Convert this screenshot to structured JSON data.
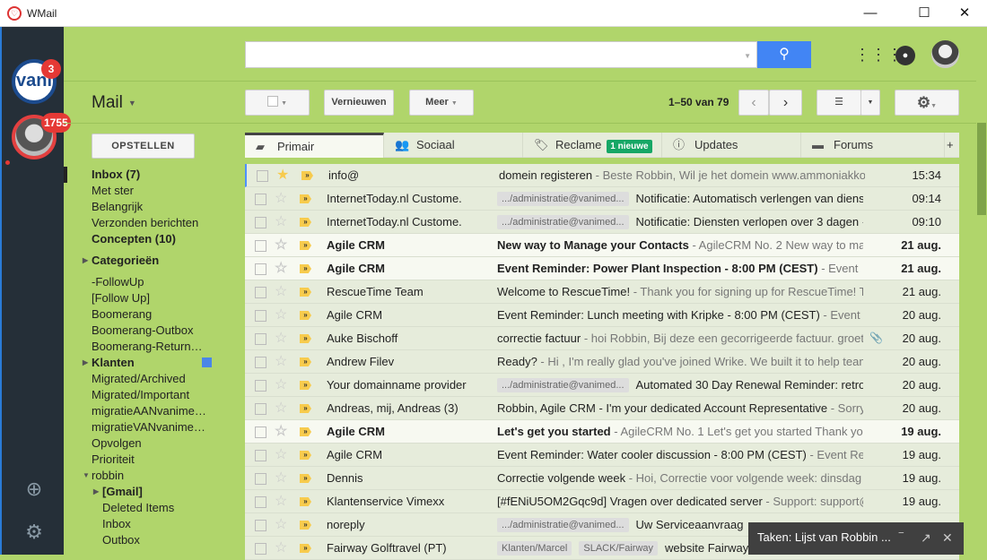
{
  "window": {
    "title": "WMail",
    "minimize": "—",
    "maximize": "☐",
    "close": "✕"
  },
  "accounts": [
    {
      "name": "vani",
      "badge": "3"
    },
    {
      "name": "robbin",
      "badge": "1755"
    }
  ],
  "search": {
    "placeholder": ""
  },
  "header": {
    "mail_label": "Mail"
  },
  "toolbar": {
    "refresh": "Vernieuwen",
    "more": "Meer",
    "pagination": "1–50 van 79"
  },
  "compose": "OPSTELLEN",
  "nav": {
    "inbox": "Inbox (7)",
    "starred": "Met ster",
    "important": "Belangrijk",
    "sent": "Verzonden berichten",
    "drafts": "Concepten (10)",
    "categories": "Categorieën",
    "labels": [
      "-FollowUp",
      "[Follow Up]",
      "Boomerang",
      "Boomerang-Outbox",
      "Boomerang-Return…"
    ],
    "klanten": "Klanten",
    "labels2": [
      "Migrated/Archived",
      "Migrated/Important",
      "migratieAANvanime…",
      "migratieVANvanime…",
      "Opvolgen",
      "Prioriteit"
    ],
    "robbin": "robbin",
    "gmail": "[Gmail]",
    "sub": [
      "Deleted Items",
      "Inbox",
      "Outbox"
    ]
  },
  "tabs": [
    {
      "label": "Primair"
    },
    {
      "label": "Sociaal"
    },
    {
      "label": "Reclame",
      "badge": "1 nieuwe"
    },
    {
      "label": "Updates"
    },
    {
      "label": "Forums"
    }
  ],
  "tab_add": "+",
  "emails": [
    {
      "from": "info@",
      "subject": "domein registeren",
      "snippet": " - Beste Robbin, Wil je het domein www.ammoniakkoe",
      "date": "15:34",
      "unread": false,
      "starred": true
    },
    {
      "from": "InternetToday.nl Custome.",
      "labels": [
        ".../administratie@vanimed..."
      ],
      "subject": "Notificatie: Automatisch verlengen van diens",
      "snippet": "",
      "date": "09:14",
      "unread": false
    },
    {
      "from": "InternetToday.nl Custome.",
      "labels": [
        ".../administratie@vanimed..."
      ],
      "subject": "Notificatie: Diensten verlopen over 3 dagen",
      "snippet": " -",
      "date": "09:10",
      "unread": false
    },
    {
      "from": "Agile CRM",
      "subject": "New way to Manage your Contacts",
      "snippet": " - AgileCRM No. 2 New way to ma",
      "date": "21 aug.",
      "unread": true
    },
    {
      "from": "Agile CRM",
      "subject": "Event Reminder: Power Plant Inspection - 8:00 PM (CEST)",
      "snippet": " - Event",
      "date": "21 aug.",
      "unread": true
    },
    {
      "from": "RescueTime Team",
      "subject": "Welcome to RescueTime!",
      "snippet": " - Thank you for signing up for RescueTime! T",
      "date": "21 aug.",
      "unread": false
    },
    {
      "from": "Agile CRM",
      "subject": "Event Reminder: Lunch meeting with Kripke - 8:00 PM (CEST)",
      "snippet": " - Event",
      "date": "20 aug.",
      "unread": false
    },
    {
      "from": "Auke Bischoff",
      "subject": "correctie factuur",
      "snippet": " - hoi Robbin, Bij deze een gecorrigeerde factuur. groet",
      "date": "20 aug.",
      "unread": false,
      "attachment": true
    },
    {
      "from": "Andrew Filev",
      "subject": "Ready?",
      "snippet": " - Hi , I'm really glad you've joined Wrike. We built it to help team",
      "date": "20 aug.",
      "unread": false
    },
    {
      "from": "Your domainname provider",
      "labels": [
        ".../administratie@vanimed..."
      ],
      "subject": "Automated 30 Day Renewal Reminder: retro",
      "snippet": "",
      "date": "20 aug.",
      "unread": false
    },
    {
      "from": "Andreas, mij, Andreas (3)",
      "subject": "Robbin, Agile CRM - I'm your dedicated Account Representative",
      "snippet": " - Sorry",
      "date": "20 aug.",
      "unread": false
    },
    {
      "from": "Agile CRM",
      "subject": "Let's get you started",
      "snippet": " - AgileCRM No. 1 Let's get you started Thank you",
      "date": "19 aug.",
      "unread": true
    },
    {
      "from": "Agile CRM",
      "subject": "Event Reminder: Water cooler discussion - 8:00 PM (CEST)",
      "snippet": " - Event Re",
      "date": "19 aug.",
      "unread": false
    },
    {
      "from": "Dennis",
      "subject": "Correctie volgende week",
      "snippet": " - Hoi, Correctie voor volgende week: dinsdag e",
      "date": "19 aug.",
      "unread": false
    },
    {
      "from": "Klantenservice Vimexx",
      "subject": "[#fENiU5OM2Gqc9d] Vragen over dedicated server",
      "snippet": " - Support: support@",
      "date": "19 aug.",
      "unread": false
    },
    {
      "from": "noreply",
      "labels": [
        ".../administratie@vanimed..."
      ],
      "subject": "Uw Serviceaanvraag",
      "snippet": "",
      "date": "",
      "unread": false
    },
    {
      "from": "Fairway Golftravel (PT)",
      "labels": [
        "Klanten/Marcel",
        "SLACK/Fairway"
      ],
      "subject": "website Fairway",
      "snippet": "",
      "date": "",
      "unread": false
    }
  ],
  "tasks": {
    "title": "Taken: Lijst van Robbin ..."
  },
  "colors": {
    "accent": "#4285f4",
    "theme": "#b0d56b",
    "rail": "#252f38",
    "badge": "#e53935"
  }
}
